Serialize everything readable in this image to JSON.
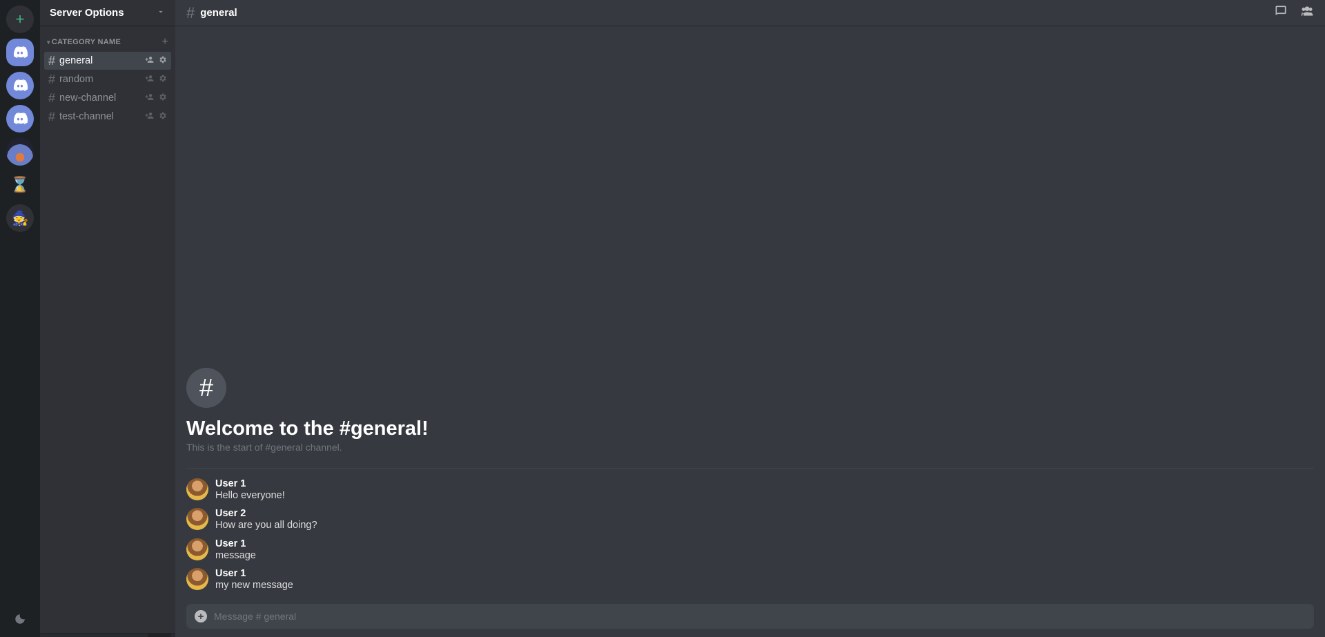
{
  "server": {
    "header_label": "Server Options"
  },
  "category": {
    "label": "CATEGORY NAME"
  },
  "channels": [
    {
      "name": "general",
      "active": true
    },
    {
      "name": "random",
      "active": false
    },
    {
      "name": "new-channel",
      "active": false
    },
    {
      "name": "test-channel",
      "active": false
    }
  ],
  "header": {
    "channel_name": "general"
  },
  "welcome": {
    "title": "Welcome to the #general!",
    "subtitle": "This is the start of #general channel."
  },
  "messages": [
    {
      "user": "User 1",
      "text": "Hello everyone!"
    },
    {
      "user": "User 2",
      "text": "How are you all doing?"
    },
    {
      "user": "User 1",
      "text": "message"
    },
    {
      "user": "User 1",
      "text": "my new message"
    }
  ],
  "composer": {
    "placeholder": "Message # general"
  },
  "guilds": {
    "hourglass_glyph": "⌛",
    "avatar_glyph": "🧙"
  }
}
